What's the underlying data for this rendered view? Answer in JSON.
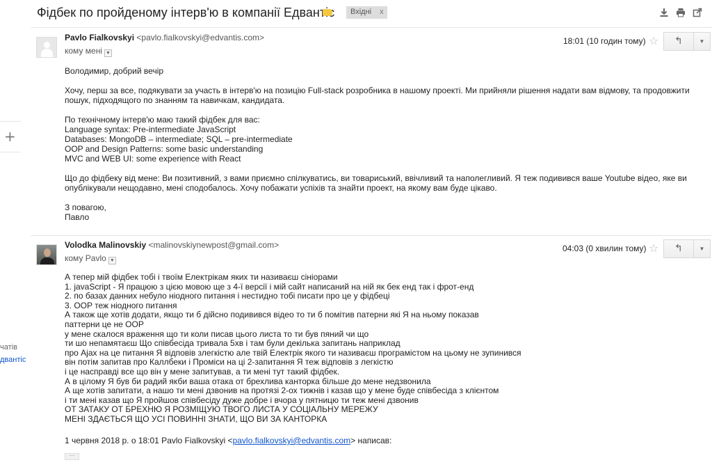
{
  "thread": {
    "subject": "Фідбек по пройденому інтерв'ю в компанії Едвантіс",
    "label_icon": "label-tag-icon",
    "label_color": "#f4c742",
    "label_chip": "Вхідні",
    "label_chip_close": "x",
    "toolbar_icons": [
      "download-icon",
      "print-icon",
      "popout-icon"
    ]
  },
  "left_rail": {
    "plus": "+",
    "text1": "чатів",
    "text2": "двантіс"
  },
  "messages": [
    {
      "sender_name": "Pavlo Fialkovskyi",
      "sender_email": "<pavlo.fialkovskyi@edvantis.com>",
      "recipient": "кому мені",
      "time": "18:01 (10 годин тому)",
      "body": [
        "Володимир, добрий вечір",
        "",
        "Хочу, перш за все, подякувати за участь в інтерв'ю на позицію Full-stack розробника в нашому проекті. Ми прийняли рішення надати вам відмову, та продовжити",
        "пошук, підходящого по знанням та навичкам, кандидата.",
        "",
        "По технічному інтерв'ю маю такий фідбек для вас:",
        "Language syntax: Pre-intermediate JavaScript",
        "Databases: MongoDB – intermediate; SQL – pre-intermediate",
        "OOP and Design Patterns: some basic understanding",
        "MVC and WEB UI: some experience with React",
        "",
        "Що до фідбеку від мене: Ви позитивний, з вами приємно спілкуватись, ви товариський, ввічливий та наполегливий. Я теж подивився ваше Youtube відео, яке ви",
        "опублікували нещодавно, мені сподобалось. Хочу побажати успіхів та знайти проект, на якому вам буде цікаво.",
        "",
        "З повагою,",
        "Павло"
      ]
    },
    {
      "sender_name": "Volodka Malinovskiy",
      "sender_email": "<malinovskiynewpost@gmail.com>",
      "recipient": "кому Pavlo",
      "time": "04:03 (0 хвилин тому)",
      "body": [
        "А тепер мій фідбек тобі і твоїм Електрікам яких ти називаєш сініорами",
        "1. javaScript - Я працюю з цією мовою ще з 4-ї версії і мій сайт написаний на ній як бек енд так і фрот-енд",
        "2. по базах данних небуло ніодного питання і нестидно тобі писати про це у фідбеці",
        "3. OOP теж ніодного питання",
        "А також ще хотів додати, якщо ти б дійсно подивився відео то ти б помітив патерни які Я на ньому показав",
        "паттерни це не OOP",
        "у мене скалося враження що ти коли писав цього листа то ти був пяний чи що",
        "ти шо непамятаєш Що співбесіда тривала 5хв і там були декілька запитань наприклад",
        "про Ajax на це питання Я відповів злегкістю але твій Електрік якого ти називаєш програмістом на цьому не зупинився",
        "він потім запитав про Каллбеки і Проміси на ці 2-запитання Я теж відповів з легкістю",
        "і це насправді все що він у мене запитував, а ти мені тут такий фідбек.",
        "А в цілому Я був би радий якби ваша отака от брехлива канторка більше до мене недзвонила",
        "А ще хотів запитати, а нашо ти мені дзвонив на протязі 2-ох тижнів і казав що у мене буде співбесіда з клієнтом",
        "і ти мені казав що Я пройшов співбесіду дуже добре і вчора у пятницю ти теж мені дзвонив",
        "ОТ ЗАТАКУ ОТ БРЕХНЮ Я РОЗМІЩУЮ ТВОГО ЛИСТА У СОЦІАЛЬНУ МЕРЕЖУ",
        "МЕНІ ЗДАЄТЬСЯ ЩО УСІ ПОВИННІ ЗНАТИ, ЩО ВИ ЗА КАНТОРКА"
      ],
      "quote_prefix": "1 червня 2018 р. о 18:01 Pavlo Fialkovskyi <",
      "quote_email": "pavlo.fialkovskyi@edvantis.com",
      "quote_suffix": "> написав:",
      "show_trimmed": "···"
    }
  ],
  "icons": {
    "star": "star-icon",
    "reply": "reply-icon",
    "more": "chevron-down-icon"
  }
}
